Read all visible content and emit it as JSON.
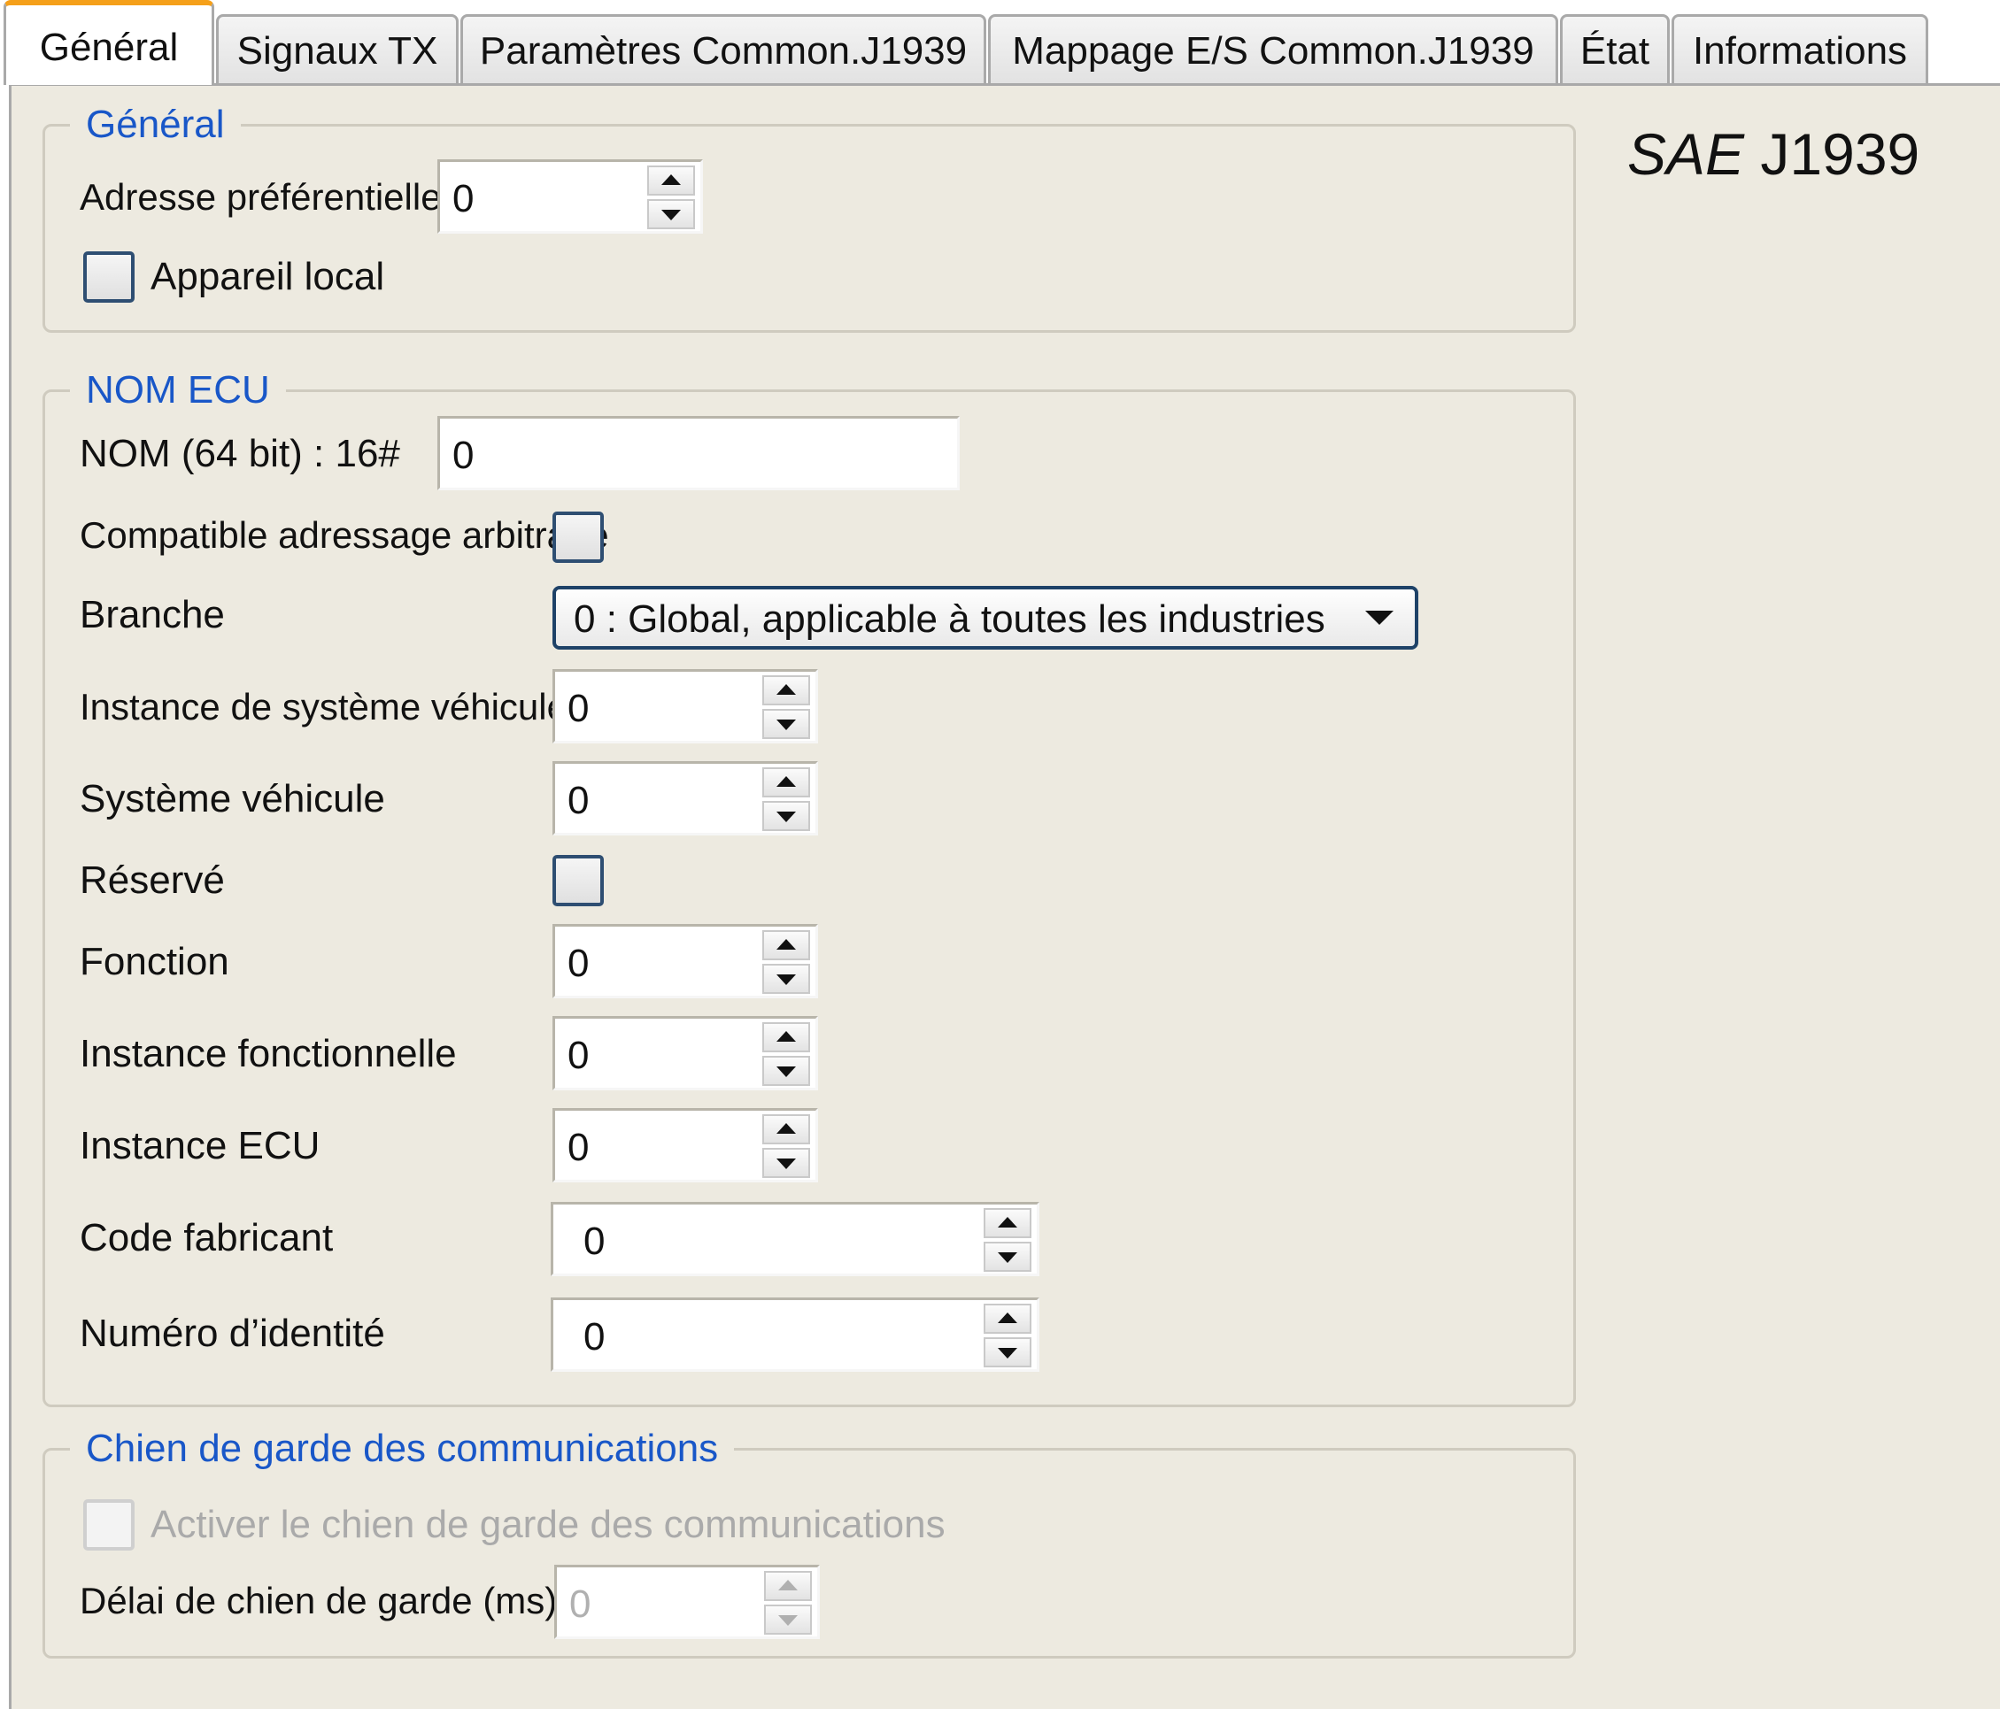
{
  "tabs": [
    {
      "label": "Général",
      "active": true
    },
    {
      "label": "Signaux TX"
    },
    {
      "label": "Paramètres Common.J1939"
    },
    {
      "label": "Mappage E/S Common.J1939"
    },
    {
      "label": "État"
    },
    {
      "label": "Informations"
    }
  ],
  "brand": {
    "prefix": "SAE",
    "suffix": "J1939"
  },
  "general": {
    "legend": "Général",
    "preferred_address_label": "Adresse préférentielle :",
    "preferred_address_value": "0",
    "local_device_label": "Appareil local",
    "local_device_checked": false
  },
  "ecu": {
    "legend": "NOM ECU",
    "name_label": "NOM (64 bit) : 16#",
    "name_value": "0",
    "arbitrary_label": "Compatible adressage arbitraire",
    "arbitrary_checked": false,
    "branch_label": "Branche",
    "branch_value": "0 : Global, applicable à toutes les industries",
    "vehicle_system_instance_label": "Instance de système véhicule",
    "vehicle_system_instance_value": "0",
    "vehicle_system_label": "Système véhicule",
    "vehicle_system_value": "0",
    "reserved_label": "Réservé",
    "reserved_checked": false,
    "function_label": "Fonction",
    "function_value": "0",
    "function_instance_label": "Instance fonctionnelle",
    "function_instance_value": "0",
    "ecu_instance_label": "Instance ECU",
    "ecu_instance_value": "0",
    "manufacturer_code_label": "Code fabricant",
    "manufacturer_code_value": "0",
    "identity_number_label": "Numéro d’identité",
    "identity_number_value": "0"
  },
  "watchdog": {
    "legend": "Chien de garde des communications",
    "enable_label": "Activer le chien de garde des communications",
    "enable_checked": false,
    "delay_label": "Délai de chien de garde (ms) :",
    "delay_value": "0"
  },
  "colors": {
    "legend": "#1957c8",
    "panel": "#edeae0",
    "active_tab_accent": "#f5a01a",
    "checkbox_border": "#2e4e72"
  }
}
